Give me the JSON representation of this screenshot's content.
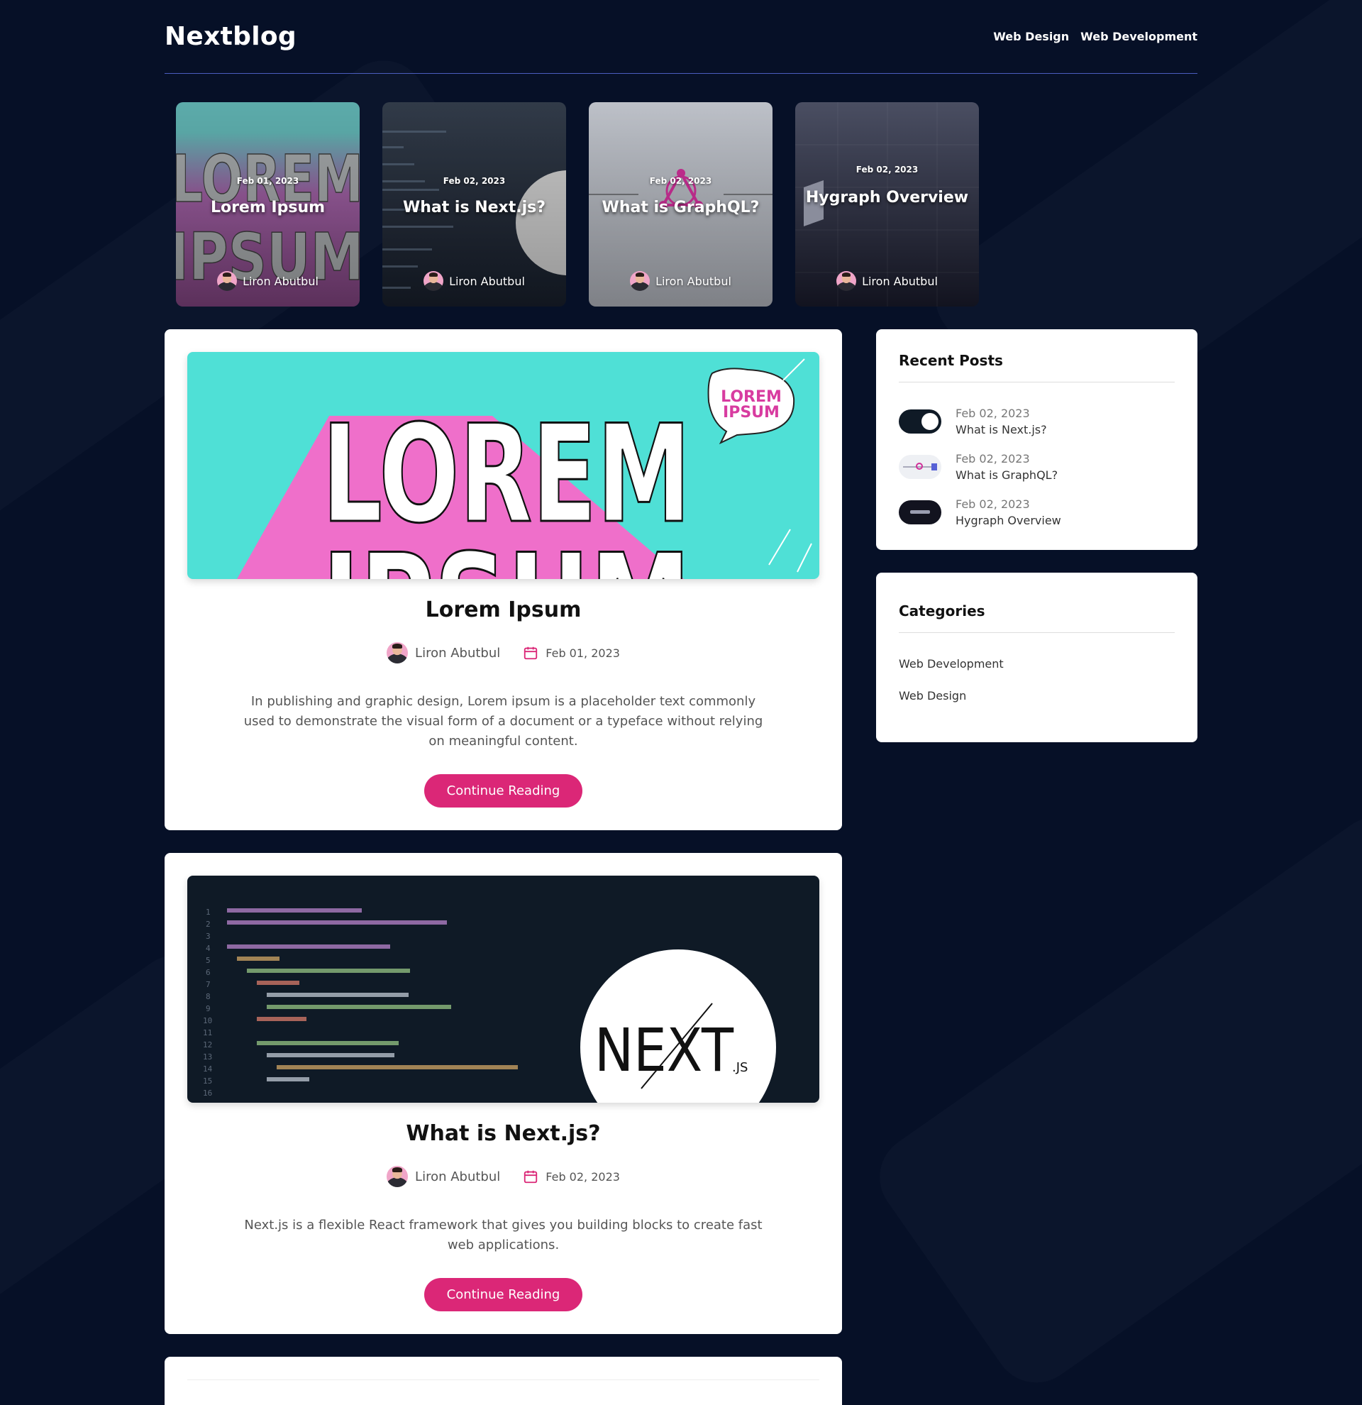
{
  "header": {
    "logo": "Nextblog",
    "nav": [
      "Web Design",
      "Web Development"
    ]
  },
  "featured": [
    {
      "date": "Feb 01, 2023",
      "title": "Lorem Ipsum",
      "author": "Liron Abutbul"
    },
    {
      "date": "Feb 02, 2023",
      "title": "What is Next.js?",
      "author": "Liron Abutbul"
    },
    {
      "date": "Feb 02, 2023",
      "title": "What is GraphQL?",
      "author": "Liron Abutbul"
    },
    {
      "date": "Feb 02, 2023",
      "title": "Hygraph Overview",
      "author": "Liron Abutbul"
    }
  ],
  "posts": [
    {
      "title": "Lorem Ipsum",
      "author": "Liron Abutbul",
      "date": "Feb 01, 2023",
      "excerpt": "In publishing and graphic design, Lorem ipsum is a placeholder text commonly used to demonstrate the visual form of a document or a typeface without relying on meaningful content.",
      "button": "Continue Reading",
      "image_text": {
        "big_line_1": "LOREM",
        "big_line_2": "IPSUM",
        "bubble_1": "LOREM",
        "bubble_2": "IPSUM"
      }
    },
    {
      "title": "What is Next.js?",
      "author": "Liron Abutbul",
      "date": "Feb 02, 2023",
      "excerpt": "Next.js is a flexible React framework that gives you building blocks to create fast web applications.",
      "button": "Continue Reading",
      "image_text": {
        "logo": "NEXT",
        "logo_suffix": ".JS"
      }
    }
  ],
  "sidebar": {
    "recent_title": "Recent Posts",
    "recent": [
      {
        "date": "Feb 02, 2023",
        "title": "What is Next.js?"
      },
      {
        "date": "Feb 02, 2023",
        "title": "What is GraphQL?"
      },
      {
        "date": "Feb 02, 2023",
        "title": "Hygraph Overview"
      }
    ],
    "categories_title": "Categories",
    "categories": [
      "Web Development",
      "Web Design"
    ]
  },
  "colors": {
    "background": "#061027",
    "accent": "#db2777",
    "divider": "#4b5dbf"
  }
}
